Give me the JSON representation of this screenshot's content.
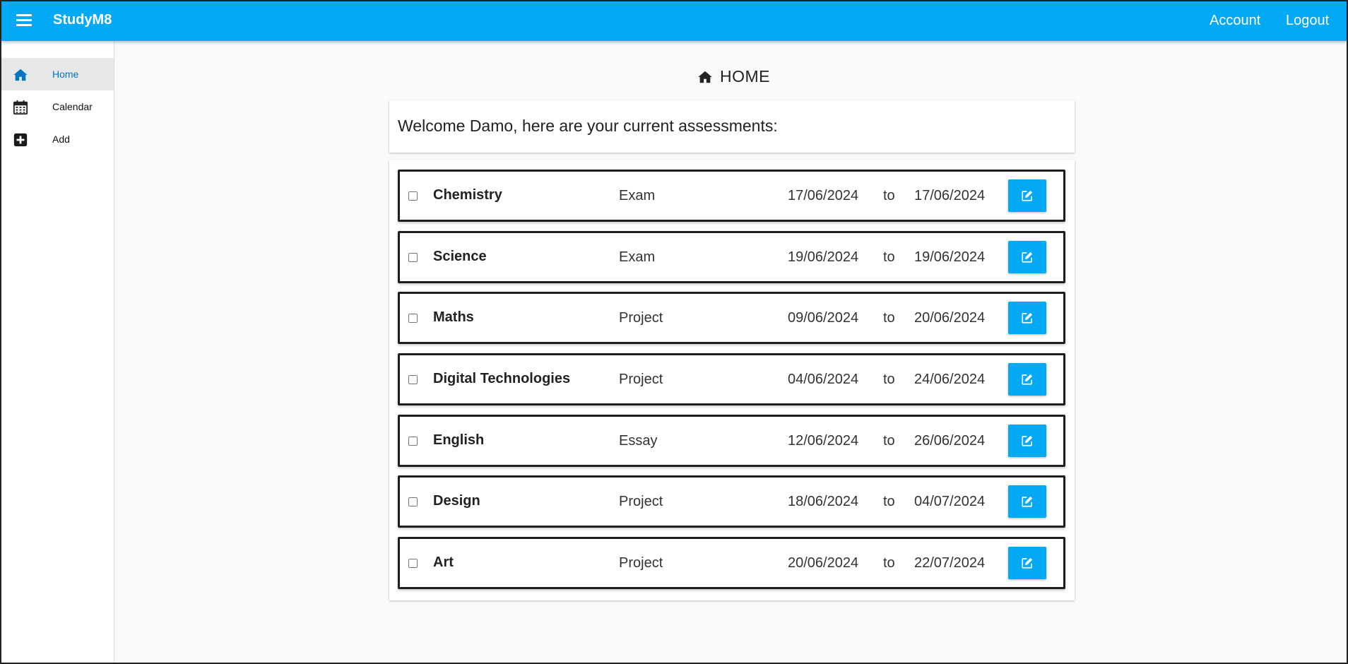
{
  "app": {
    "brand": "StudyM8"
  },
  "header": {
    "account_label": "Account",
    "logout_label": "Logout"
  },
  "sidebar": {
    "items": [
      {
        "label": "Home",
        "icon": "home-icon",
        "active": true
      },
      {
        "label": "Calendar",
        "icon": "calendar-icon",
        "active": false
      },
      {
        "label": "Add",
        "icon": "plus-square-icon",
        "active": false
      }
    ]
  },
  "main": {
    "title": "HOME",
    "welcome": "Welcome Damo, here are your current assessments:",
    "to_label": "to",
    "assessments": [
      {
        "subject": "Chemistry",
        "type": "Exam",
        "start": "17/06/2024",
        "end": "17/06/2024",
        "checked": false
      },
      {
        "subject": "Science",
        "type": "Exam",
        "start": "19/06/2024",
        "end": "19/06/2024",
        "checked": false
      },
      {
        "subject": "Maths",
        "type": "Project",
        "start": "09/06/2024",
        "end": "20/06/2024",
        "checked": false
      },
      {
        "subject": "Digital Technologies",
        "type": "Project",
        "start": "04/06/2024",
        "end": "24/06/2024",
        "checked": false
      },
      {
        "subject": "English",
        "type": "Essay",
        "start": "12/06/2024",
        "end": "26/06/2024",
        "checked": false
      },
      {
        "subject": "Design",
        "type": "Project",
        "start": "18/06/2024",
        "end": "04/07/2024",
        "checked": false
      },
      {
        "subject": "Art",
        "type": "Project",
        "start": "20/06/2024",
        "end": "22/07/2024",
        "checked": false
      }
    ]
  },
  "colors": {
    "accent": "#03a9f4",
    "active_link": "#0277bd",
    "background": "#fafafa"
  }
}
